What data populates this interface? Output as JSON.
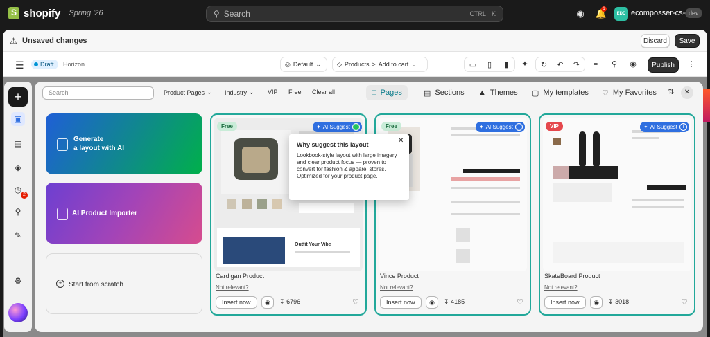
{
  "topbar": {
    "brand": "shopify",
    "edition": "Spring '26",
    "search_placeholder": "Search",
    "shortcut_ctrl": "CTRL",
    "shortcut_key": "K",
    "notification_count": "1",
    "store_avatar": "EDD",
    "store_name": "ecomposser-cs-dev",
    "store_tag": "dev"
  },
  "unsaved_bar": {
    "message": "Unsaved changes",
    "discard_label": "Discard",
    "save_label": "Save"
  },
  "editor_toolbar": {
    "status": "Draft",
    "theme": "Horizon",
    "template_select": "Default",
    "breadcrumb_1": "Products",
    "breadcrumb_sep": ">",
    "breadcrumb_2": "Add to cart",
    "publish_label": "Publish"
  },
  "rail": {
    "notification_count": "2"
  },
  "filters": {
    "search_placeholder": "Search",
    "page_type": "Product Pages",
    "industry": "Industry",
    "vip": "VIP",
    "free": "Free",
    "clear": "Clear all"
  },
  "tabs": [
    {
      "label": "Pages",
      "active": true
    },
    {
      "label": "Sections",
      "active": false
    },
    {
      "label": "Themes",
      "active": false
    },
    {
      "label": "My templates",
      "active": false
    },
    {
      "label": "My Favorites",
      "active": false
    }
  ],
  "left_cards": {
    "generate_line1": "Generate",
    "generate_line2": "a layout with AI",
    "importer": "AI Product Importer",
    "scratch": "Start from scratch"
  },
  "templates": [
    {
      "name": "Cardigan Product",
      "tag": "Free",
      "ai_label": "AI Suggest",
      "not_relevant": "Not relevant?",
      "insert_label": "Insert now",
      "downloads": "6796",
      "preview_headline": "Outfit Your Vibe"
    },
    {
      "name": "Vince Product",
      "tag": "Free",
      "ai_label": "AI Suggest",
      "not_relevant": "Not relevant?",
      "insert_label": "Insert now",
      "downloads": "4185"
    },
    {
      "name": "SkateBoard Product",
      "tag": "VIP",
      "ai_label": "AI Suggest",
      "not_relevant": "Not relevant?",
      "insert_label": "Insert now",
      "downloads": "3018"
    }
  ],
  "popover": {
    "title": "Why suggest this layout",
    "body": "Lookbook-style layout with large imagery and clear product focus — proven to convert for fashion & apparel stores. Optimized for your product page."
  },
  "colors": {
    "accent_teal": "#22a89a",
    "ai_blue": "#2f6fe0",
    "vip_red": "#e5484d"
  }
}
